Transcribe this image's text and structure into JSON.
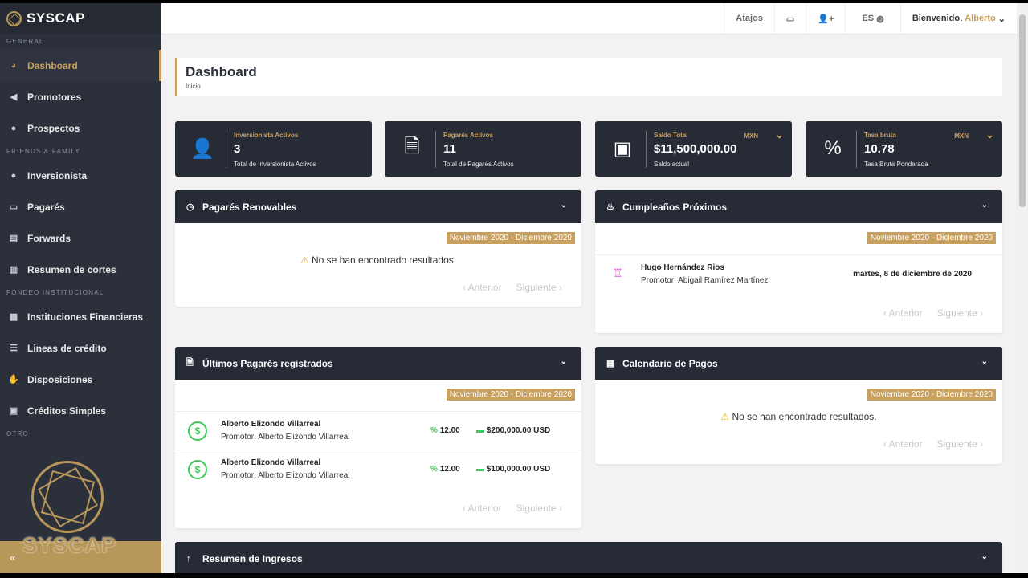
{
  "brand": "SYSCAP",
  "sidebar": {
    "sections": [
      "GENERAL",
      "FRIENDS & FAMILY",
      "FONDEO INSTITUCIONAL",
      "OTRO"
    ],
    "items": [
      {
        "label": "Dashboard",
        "icon": "gauge-icon"
      },
      {
        "label": "Promotores",
        "icon": "megaphone-icon"
      },
      {
        "label": "Prospectos",
        "icon": "users-icon"
      },
      {
        "label": "Inversionista",
        "icon": "user-icon"
      },
      {
        "label": "Pagarés",
        "icon": "money-icon"
      },
      {
        "label": "Forwards",
        "icon": "card-icon"
      },
      {
        "label": "Resumen de cortes",
        "icon": "bar-chart-icon"
      },
      {
        "label": "Instituciones Financieras",
        "icon": "bank-icon"
      },
      {
        "label": "Lineas de crédito",
        "icon": "list-icon"
      },
      {
        "label": "Disposiciones",
        "icon": "hand-icon"
      },
      {
        "label": "Créditos Simples",
        "icon": "cash-icon"
      }
    ],
    "collapse": "«"
  },
  "topbar": {
    "shortcuts": "Atajos",
    "lang": "ES",
    "welcome": "Bienvenido,",
    "user": "Alberto"
  },
  "header": {
    "title": "Dashboard",
    "breadcrumb": "Inicio"
  },
  "cards": [
    {
      "label": "Inversionista Activos",
      "value": "3",
      "sub": "Total de Inversionista Activos"
    },
    {
      "label": "Pagarés Activos",
      "value": "11",
      "sub": "Total de Pagarés Activos"
    },
    {
      "label": "Saldo Total",
      "value": "$11,500,000.00",
      "sub": "Saldo actual",
      "currency": "MXN"
    },
    {
      "label": "Tasa bruta",
      "value": "10.78",
      "sub": "Tasa Bruta Ponderada",
      "currency": "MXN"
    }
  ],
  "panels": {
    "renovables": {
      "title": "Pagarés Renovables",
      "range": "Noviembre 2020 - Diciembre 2020",
      "empty": "No se han encontrado resultados."
    },
    "cumple": {
      "title": "Cumpleaños Próximos",
      "range": "Noviembre 2020 - Diciembre 2020",
      "name": "Hugo Hernández Rios",
      "prom": "Promotor: Abigail Ramírez Martínez",
      "date": "martes, 8 de diciembre de 2020"
    },
    "ultimos": {
      "title": "Últimos Pagarés registrados",
      "range": "Noviembre 2020 - Diciembre 2020",
      "rows": [
        {
          "name": "Alberto Elizondo Villarreal",
          "prom": "Promotor: Alberto Elizondo Villarreal",
          "rate": "12.00",
          "amount": "$200,000.00 USD"
        },
        {
          "name": "Alberto Elizondo Villarreal",
          "prom": "Promotor: Alberto Elizondo Villarreal",
          "rate": "12.00",
          "amount": "$100,000.00 USD"
        }
      ]
    },
    "calendario": {
      "title": "Calendario de Pagos",
      "range": "Noviembre 2020 - Diciembre 2020",
      "empty": "No se han encontrado resultados."
    },
    "ingresos": {
      "title": "Resumen de Ingresos"
    }
  },
  "pager": {
    "prev": "Anterior",
    "next": "Siguiente"
  }
}
